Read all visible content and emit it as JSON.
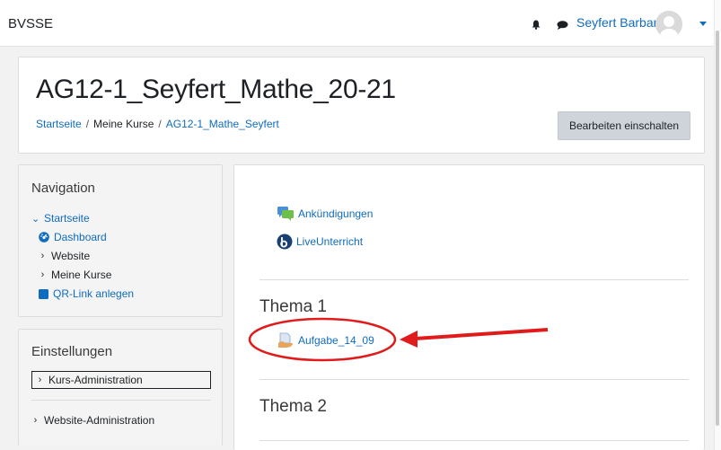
{
  "navbar": {
    "brand": "BVSSE",
    "user_name": "Seyfert Barbara",
    "icons": [
      "bell-icon",
      "chat-icon",
      "avatar",
      "caret-down-icon"
    ]
  },
  "header": {
    "title": "AG12-1_Seyfert_Mathe_20-21",
    "breadcrumb": [
      "Startseite",
      "Meine Kurse",
      "AG12-1_Mathe_Seyfert"
    ],
    "edit_button": "Bearbeiten einschalten"
  },
  "navigation": {
    "title": "Navigation",
    "items": [
      {
        "label": "Startseite",
        "icon": "chevron-down-icon"
      },
      {
        "label": "Dashboard",
        "icon": "dashboard-icon"
      },
      {
        "label": "Website",
        "icon": "chevron-right-icon"
      },
      {
        "label": "Meine Kurse",
        "icon": "chevron-right-icon"
      },
      {
        "label": "QR-Link anlegen",
        "icon": "square-icon"
      }
    ]
  },
  "settings": {
    "title": "Einstellungen",
    "items": [
      {
        "label": "Kurs-Administration",
        "icon": "chevron-right-icon"
      },
      {
        "label": "Website-Administration",
        "icon": "chevron-right-icon"
      }
    ]
  },
  "main": {
    "activities": [
      {
        "label": "Ankündigungen",
        "icon": "forum-icon"
      },
      {
        "label": "LiveUnterricht",
        "icon": "bigbluebutton-icon"
      }
    ],
    "sections": [
      {
        "title": "Thema 1",
        "activities": [
          {
            "label": "Aufgabe_14_09",
            "icon": "assignment-icon"
          }
        ]
      },
      {
        "title": "Thema 2",
        "activities": []
      }
    ]
  },
  "colors": {
    "link": "#0f6cbf",
    "annotation": "#e01b1b",
    "button_bg": "#ced4da",
    "page_bg": "#f2f2f2"
  }
}
